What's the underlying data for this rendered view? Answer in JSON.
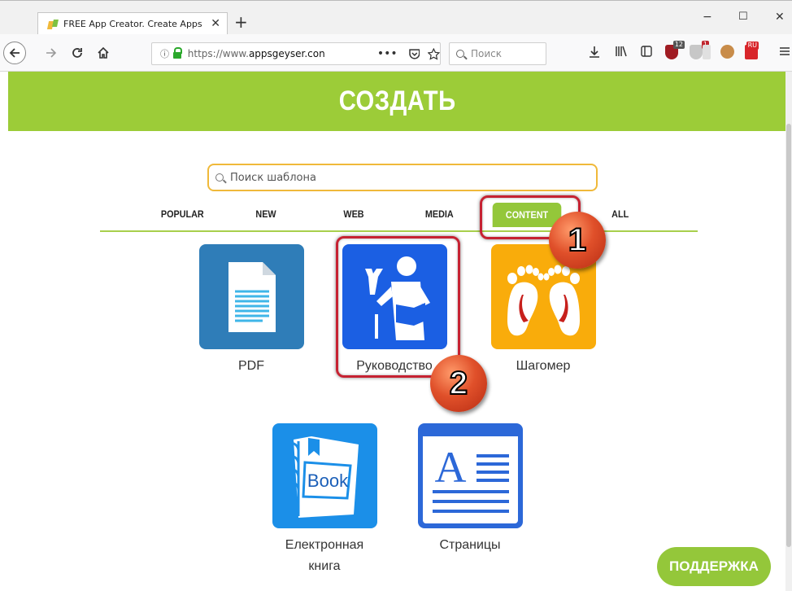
{
  "browser": {
    "tab_title": "FREE App Creator. Create Apps",
    "new_tab": "+",
    "minimize": "−",
    "maximize": "☐",
    "close": "✕",
    "url_info": "ⓘ",
    "url_prefix": "https://www.",
    "url_domain": "appsgeyser.con",
    "url_more": "•••",
    "search_placeholder": "Поиск",
    "ext_badge_1": "12",
    "ext_badge_2": "1",
    "ext_badge_3": "RU"
  },
  "page": {
    "hero_title": "СОЗДАТЬ",
    "template_search_placeholder": "Поиск шаблона",
    "categories": [
      "POPULAR",
      "NEW",
      "WEB",
      "MEDIA",
      "CONTENT",
      "ALL"
    ],
    "active_category": "CONTENT",
    "templates": [
      {
        "label": "PDF",
        "icon": "pdf-document-icon",
        "color": "#2f7db8"
      },
      {
        "label": "Руководство",
        "icon": "manual-reader-icon",
        "color": "#1b5fe3"
      },
      {
        "label": "Шагомер",
        "icon": "footprints-icon",
        "color": "#f9ac0b"
      },
      {
        "label": "Електронная книга",
        "label_line1": "Електронная",
        "label_line2": "книга",
        "icon": "ebook-icon",
        "color": "#1b8fe8"
      },
      {
        "label": "Страницы",
        "icon": "text-page-icon",
        "color": "#2c68d8"
      }
    ],
    "book_word": "Book",
    "support_button": "ПОДДЕРЖКА"
  },
  "annotations": {
    "step_1": "1",
    "step_2": "2",
    "highlight_color": "#c62232"
  },
  "colors": {
    "brand_green": "#9ccc38",
    "search_border": "#f0b93a"
  }
}
